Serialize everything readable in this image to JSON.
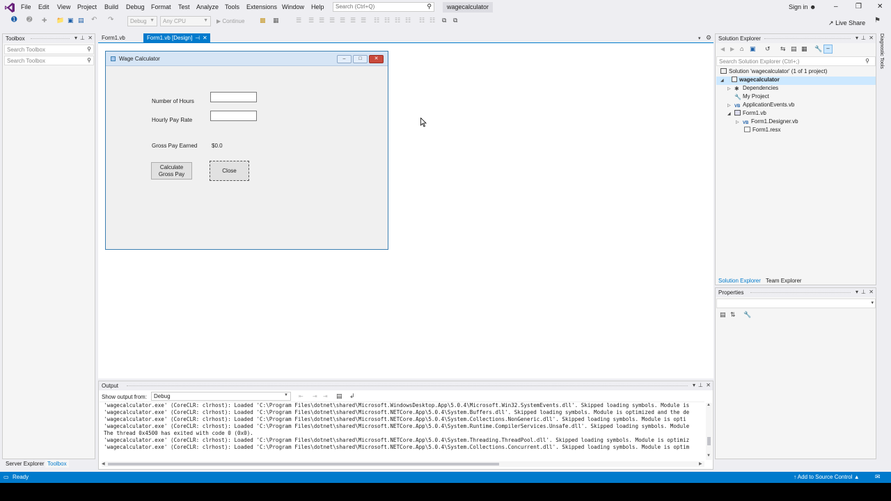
{
  "menu": [
    "File",
    "Edit",
    "View",
    "Project",
    "Build",
    "Debug",
    "Format",
    "Test",
    "Analyze",
    "Tools",
    "Extensions",
    "Window",
    "Help"
  ],
  "search": {
    "placeholder": "Search (Ctrl+Q)"
  },
  "solution_chip": "wagecalculator",
  "account": {
    "signin": "Sign in"
  },
  "toolbar": {
    "config": "Debug",
    "platform": "Any CPU",
    "continue": "Continue",
    "live_share": "Live Share"
  },
  "toolbox": {
    "title": "Toolbox",
    "search1": "Search Toolbox",
    "search2": "Search Toolbox"
  },
  "tabs": [
    {
      "label": "Form1.vb"
    },
    {
      "label": "Form1.vb [Design]"
    }
  ],
  "form": {
    "title": "Wage Calculator",
    "hours_label": "Number of Hours",
    "rate_label": "Hourly Pay Rate",
    "gross_label": "Gross Pay Earned",
    "gross_value": "$0.0",
    "calc_button": "Calculate Gross Pay",
    "close_button": "Close"
  },
  "solution_explorer": {
    "title": "Solution Explorer",
    "search": "Search Solution Explorer (Ctrl+;)",
    "items": [
      {
        "label": "Solution 'wagecalculator' (1 of 1 project)"
      },
      {
        "label": "wagecalculator"
      },
      {
        "label": "Dependencies"
      },
      {
        "label": "My Project"
      },
      {
        "label": "ApplicationEvents.vb"
      },
      {
        "label": "Form1.vb"
      },
      {
        "label": "Form1.Designer.vb"
      },
      {
        "label": "Form1.resx"
      }
    ],
    "tabs": [
      "Solution Explorer",
      "Team Explorer"
    ]
  },
  "properties": {
    "title": "Properties"
  },
  "diagnostic_tools": "Diagnostic Tools",
  "output": {
    "title": "Output",
    "show_from_label": "Show output from:",
    "show_from_value": "Debug",
    "lines": [
      "'wagecalculator.exe' (CoreCLR: clrhost): Loaded 'C:\\Program Files\\dotnet\\shared\\Microsoft.WindowsDesktop.App\\5.0.4\\Microsoft.Win32.SystemEvents.dll'. Skipped loading symbols. Module is",
      "'wagecalculator.exe' (CoreCLR: clrhost): Loaded 'C:\\Program Files\\dotnet\\shared\\Microsoft.NETCore.App\\5.0.4\\System.Buffers.dll'. Skipped loading symbols. Module is optimized and the de",
      "'wagecalculator.exe' (CoreCLR: clrhost): Loaded 'C:\\Program Files\\dotnet\\shared\\Microsoft.NETCore.App\\5.0.4\\System.Collections.NonGeneric.dll'. Skipped loading symbols. Module is opti",
      "'wagecalculator.exe' (CoreCLR: clrhost): Loaded 'C:\\Program Files\\dotnet\\shared\\Microsoft.NETCore.App\\5.0.4\\System.Runtime.CompilerServices.Unsafe.dll'. Skipped loading symbols. Module",
      "The thread 0x4500 has exited with code 0 (0x0).",
      "'wagecalculator.exe' (CoreCLR: clrhost): Loaded 'C:\\Program Files\\dotnet\\shared\\Microsoft.NETCore.App\\5.0.4\\System.Threading.ThreadPool.dll'. Skipped loading symbols. Module is optimiz",
      "'wagecalculator.exe' (CoreCLR: clrhost): Loaded 'C:\\Program Files\\dotnet\\shared\\Microsoft.NETCore.App\\5.0.4\\System.Collections.Concurrent.dll'. Skipped loading symbols. Module is optim"
    ]
  },
  "bottom_tabs": [
    "Server Explorer",
    "Toolbox"
  ],
  "status": {
    "ready": "Ready",
    "source_control": "Add to Source Control"
  },
  "colors": {
    "accent": "#007acc",
    "chrome": "#eeeef2",
    "selection": "#cce8ff"
  }
}
